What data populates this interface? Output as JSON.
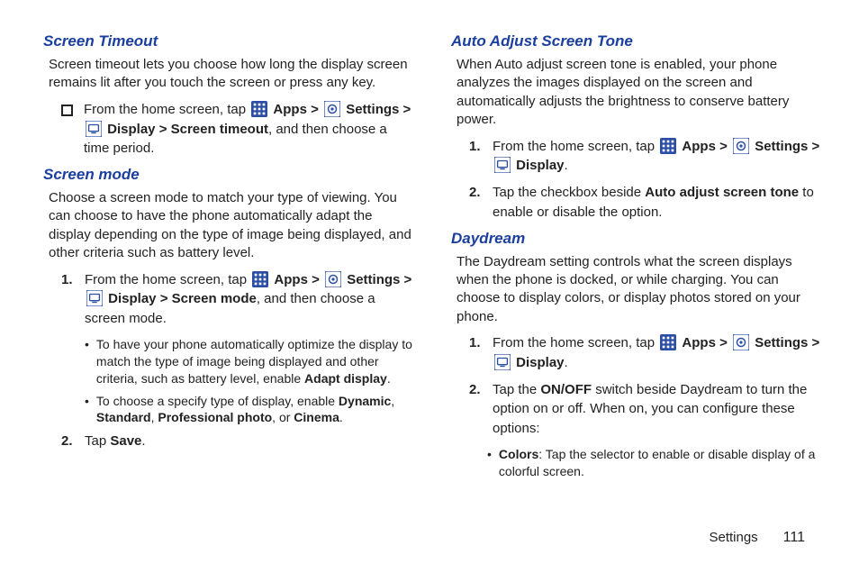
{
  "left": {
    "s1_h": "Screen Timeout",
    "s1_desc": "Screen timeout lets you choose how long the display screen remains lit after you touch the screen or press any key.",
    "s1_item_a": "From the home screen, tap ",
    "s1_item_b": "Apps > ",
    "s1_item_c": "Settings > ",
    "s1_item_d": "Display > Screen timeout",
    "s1_item_e": ", and then choose a time period.",
    "s2_h": "Screen mode",
    "s2_desc": "Choose a screen mode to match your type of viewing. You can choose to have the phone automatically adapt the display depending on the type of image being displayed, and other criteria such as battery level.",
    "s2_n1": "1.",
    "s2_n1_a": "From the home screen, tap ",
    "s2_n1_b": "Apps > ",
    "s2_n1_c": "Settings > ",
    "s2_n1_d": "Display > Screen mode",
    "s2_n1_e": ", and then choose a screen mode.",
    "s2_b1_a": "To have your phone automatically optimize the display to match the type of image being displayed and other criteria, such as battery level, enable ",
    "s2_b1_b": "Adapt display",
    "s2_b1_c": ".",
    "s2_b2_a": "To choose a specify type of display, enable ",
    "s2_b2_b": "Dynamic",
    "s2_b2_c": ", ",
    "s2_b2_d": "Standard",
    "s2_b2_e": ", ",
    "s2_b2_f": "Professional photo",
    "s2_b2_g": ", or ",
    "s2_b2_h": "Cinema",
    "s2_b2_i": ".",
    "s2_n2": "2.",
    "s2_n2_a": "Tap ",
    "s2_n2_b": "Save",
    "s2_n2_c": "."
  },
  "right": {
    "s3_h": "Auto Adjust Screen Tone",
    "s3_desc": "When Auto adjust screen tone is enabled, your phone analyzes the images displayed on the screen and automatically adjusts the brightness to conserve battery power.",
    "s3_n1": "1.",
    "s3_n1_a": "From the home screen, tap ",
    "s3_n1_b": "Apps > ",
    "s3_n1_c": "Settings > ",
    "s3_n1_d": "Display",
    "s3_n1_e": ".",
    "s3_n2": "2.",
    "s3_n2_a": "Tap the checkbox beside ",
    "s3_n2_b": "Auto adjust screen tone",
    "s3_n2_c": " to enable or disable the option.",
    "s4_h": "Daydream",
    "s4_desc": "The Daydream setting controls what the screen displays when the phone is docked, or while charging. You can choose to display colors, or display photos stored on your phone.",
    "s4_n1": "1.",
    "s4_n1_a": "From the home screen, tap ",
    "s4_n1_b": "Apps > ",
    "s4_n1_c": "Settings > ",
    "s4_n1_d": "Display",
    "s4_n1_e": ".",
    "s4_n2": "2.",
    "s4_n2_a": "Tap the ",
    "s4_n2_b": "ON/OFF",
    "s4_n2_c": " switch beside Daydream to turn the option on or off. When on, you can configure these options:",
    "s4_b1_a": "Colors",
    "s4_b1_b": ": Tap the selector to enable or disable display of a colorful screen."
  },
  "footer": {
    "section": "Settings",
    "page": "111"
  }
}
